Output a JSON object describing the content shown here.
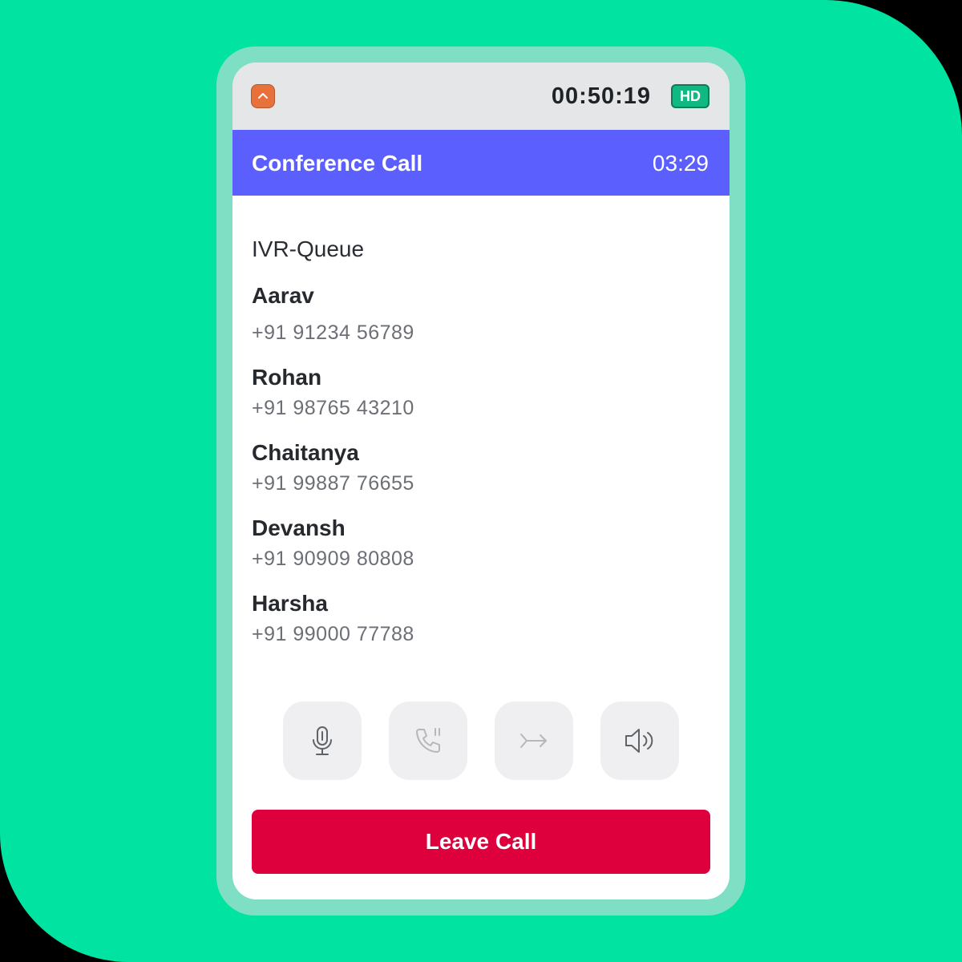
{
  "status_bar": {
    "timer": "00:50:19",
    "hd_badge": "HD",
    "collapse_icon": "chevron-up-icon"
  },
  "call": {
    "title": "Conference Call",
    "duration": "03:29"
  },
  "queue_label": "IVR-Queue",
  "participants": [
    {
      "name": "Aarav",
      "phone": "+91 91234 56789"
    },
    {
      "name": "Rohan",
      "phone": "+91 98765 43210"
    },
    {
      "name": "Chaitanya",
      "phone": "+91 99887 76655"
    },
    {
      "name": "Devansh",
      "phone": "+91 90909 80808"
    },
    {
      "name": "Harsha",
      "phone": "+91 99000 77788"
    }
  ],
  "controls": [
    {
      "icon": "microphone-icon",
      "state": "enabled"
    },
    {
      "icon": "phone-hold-icon",
      "state": "dimmed"
    },
    {
      "icon": "transfer-icon",
      "state": "dimmed"
    },
    {
      "icon": "speaker-icon",
      "state": "enabled"
    }
  ],
  "leave_button": "Leave Call",
  "colors": {
    "background": "#00e3a1",
    "header": "#5b5ffd",
    "leave_button": "#de003c",
    "hd_badge": "#10b981",
    "collapse_button": "#e8703a"
  }
}
